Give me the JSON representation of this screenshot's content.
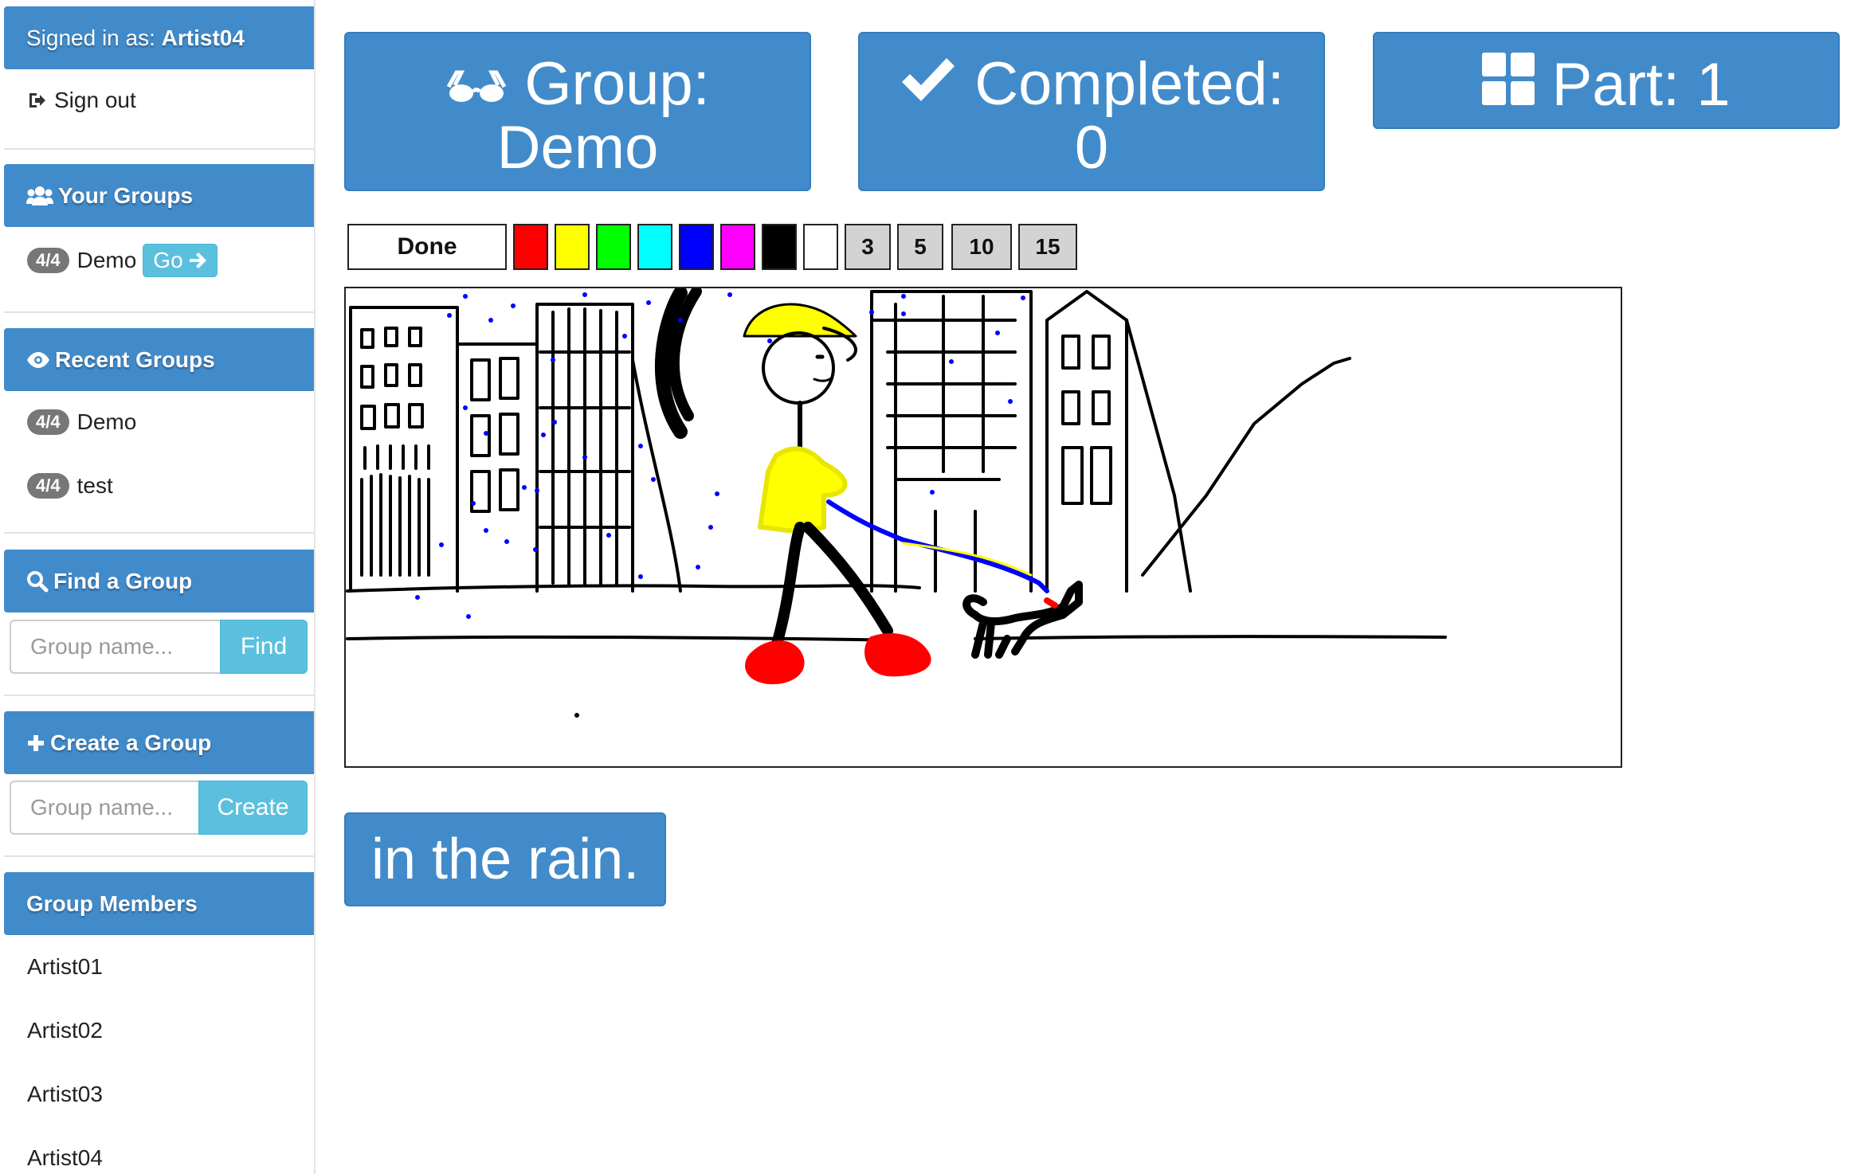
{
  "sidebar": {
    "signed_in_prefix": "Signed in as: ",
    "signed_in_user": "Artist04",
    "sign_out": "Sign out",
    "your_groups": {
      "title": "Your Groups",
      "items": [
        {
          "badge": "4/4",
          "name": "Demo",
          "go_label": "Go"
        }
      ]
    },
    "recent_groups": {
      "title": "Recent Groups",
      "items": [
        {
          "badge": "4/4",
          "name": "Demo"
        },
        {
          "badge": "4/4",
          "name": "test"
        }
      ]
    },
    "find_group": {
      "title": "Find a Group",
      "placeholder": "Group name...",
      "button": "Find"
    },
    "create_group": {
      "title": "Create a Group",
      "placeholder": "Group name...",
      "button": "Create"
    },
    "members": {
      "title": "Group Members",
      "items": [
        "Artist01",
        "Artist02",
        "Artist03",
        "Artist04"
      ]
    }
  },
  "stats": {
    "group_label": "Group:",
    "group_value": "Demo",
    "completed_label": "Completed:",
    "completed_value": "0",
    "part_label": "Part: 1"
  },
  "toolbar": {
    "done_label": "Done",
    "colors": [
      "#ff0000",
      "#ffff00",
      "#00ff00",
      "#00ffff",
      "#0000ff",
      "#ff00ff",
      "#000000",
      "#ffffff"
    ],
    "sizes": [
      "3",
      "5",
      "10",
      "15"
    ]
  },
  "caption": "in the rain.",
  "theme": {
    "primary": "#428bca",
    "info": "#5bc0de",
    "badge": "#777777"
  }
}
